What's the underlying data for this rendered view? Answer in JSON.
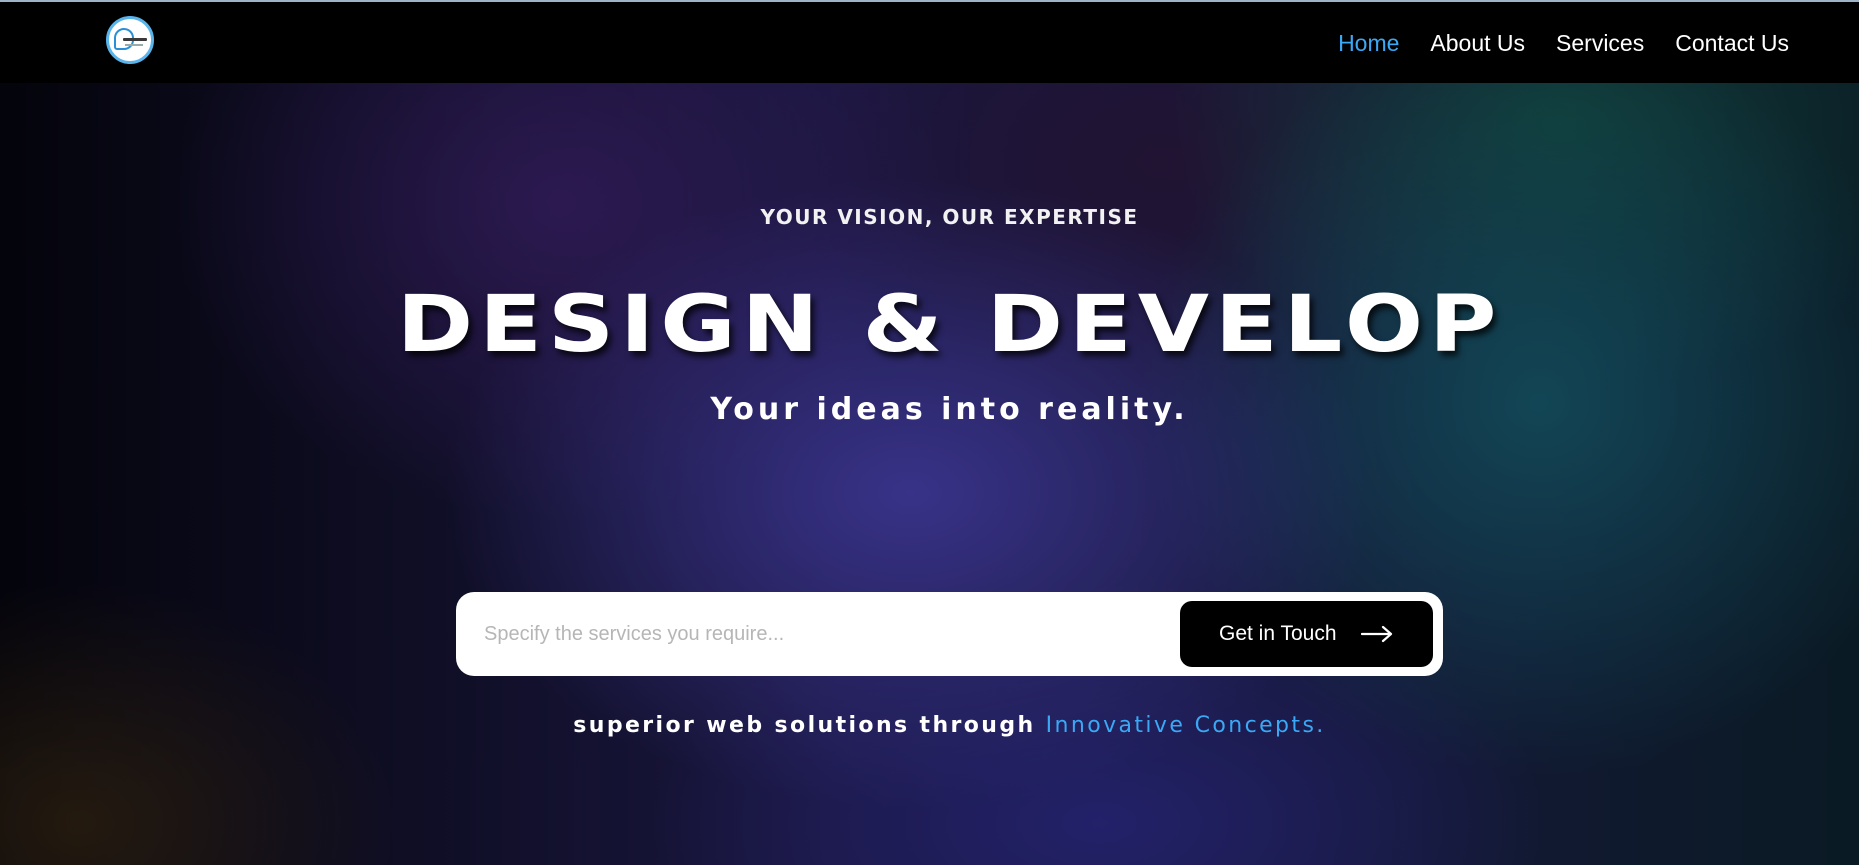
{
  "header": {
    "logo_icon": "company-logo-icon",
    "nav": [
      {
        "label": "Home",
        "active": true
      },
      {
        "label": "About Us",
        "active": false
      },
      {
        "label": "Services",
        "active": false
      },
      {
        "label": "Contact Us",
        "active": false
      }
    ]
  },
  "hero": {
    "eyebrow": "YOUR VISION, OUR EXPERTISE",
    "headline": "DESIGN & DEVELOP",
    "tagline": "Your ideas into reality.",
    "search": {
      "placeholder": "Specify the services you require...",
      "value": ""
    },
    "cta": {
      "label": "Get in Touch",
      "icon": "arrow-right-icon"
    },
    "subline": {
      "text": "superior web solutions through",
      "highlight": "Innovative Concepts."
    }
  },
  "colors": {
    "accent": "#3aa8f5",
    "nav_bg": "#000000",
    "button_bg": "#000000",
    "text": "#ffffff"
  }
}
